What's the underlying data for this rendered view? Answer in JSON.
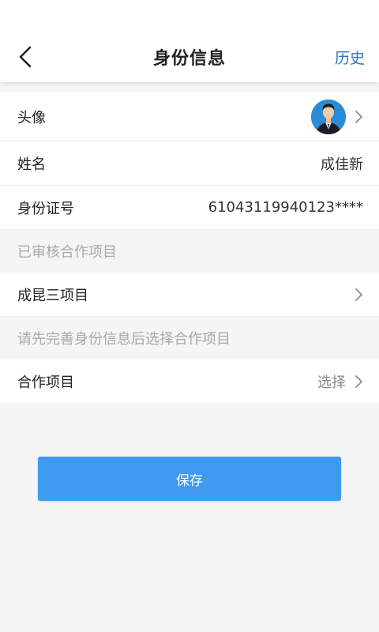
{
  "header": {
    "title": "身份信息",
    "history_label": "历史"
  },
  "rows": {
    "avatar_label": "头像",
    "name_label": "姓名",
    "name_value": "成佳新",
    "id_label": "身份证号",
    "id_value": "61043119940123****"
  },
  "sections": {
    "approved": "已审核合作项目",
    "hint": "请先完善身份信息后选择合作项目"
  },
  "approved_project": {
    "label": "成昆三项目"
  },
  "cooperation": {
    "label": "合作项目",
    "value": "选择"
  },
  "save_label": "保存",
  "colors": {
    "accent": "#3e9bf0",
    "link": "#2a78c8"
  }
}
